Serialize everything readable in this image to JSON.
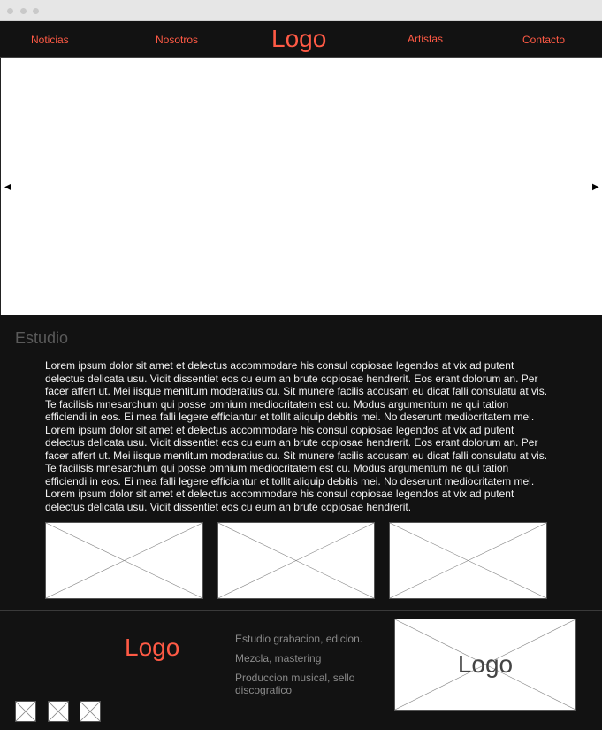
{
  "nav": {
    "items": [
      "Noticias",
      "Nosotros",
      "Artistas",
      "Contacto"
    ],
    "logo": "Logo"
  },
  "slider": {
    "prev_icon": "triangle-left-icon",
    "next_icon": "triangle-right-icon",
    "prev_glyph": "◀",
    "next_glyph": "▶"
  },
  "studio": {
    "title": "Estudio",
    "text": "Lorem ipsum dolor sit amet et delectus accommodare his consul copiosae legendos at vix ad putent delectus delicata usu. Vidit dissentiet eos cu eum an brute copiosae hendrerit. Eos erant dolorum an. Per facer affert ut. Mei iisque mentitum moderatius cu. Sit munere facilis accusam eu dicat falli consulatu at vis. Te facilisis mnesarchum qui posse omnium mediocritatem est cu. Modus argumentum ne qui tation efficiendi in eos. Ei mea falli legere efficiantur et tollit aliquip debitis mei. No deserunt mediocritatem mel. Lorem ipsum dolor sit amet et delectus accommodare his consul copiosae legendos at vix ad putent delectus delicata usu. Vidit dissentiet eos cu eum an brute copiosae hendrerit. Eos erant dolorum an. Per facer affert ut. Mei iisque mentitum moderatius cu. Sit munere facilis accusam eu dicat falli consulatu at vis. Te facilisis mnesarchum qui posse omnium mediocritatem est cu. Modus argumentum ne qui tation efficiendi in eos. Ei mea falli legere efficiantur et tollit aliquip debitis mei. No deserunt mediocritatem mel. Lorem ipsum dolor sit amet et delectus accommodare his consul copiosae legendos at vix ad putent delectus delicata usu. Vidit dissentiet eos cu eum an brute copiosae hendrerit."
  },
  "footer": {
    "logo": "Logo",
    "items": [
      "Estudio grabacion, edicion.",
      "Mezcla, mastering",
      "Produccion musical, sello discografico"
    ],
    "image_logo": "Logo"
  },
  "colors": {
    "accent": "#ff5a45",
    "background_dark": "#121212",
    "text_light": "#f2f2f2",
    "muted": "#8a8a8a"
  }
}
